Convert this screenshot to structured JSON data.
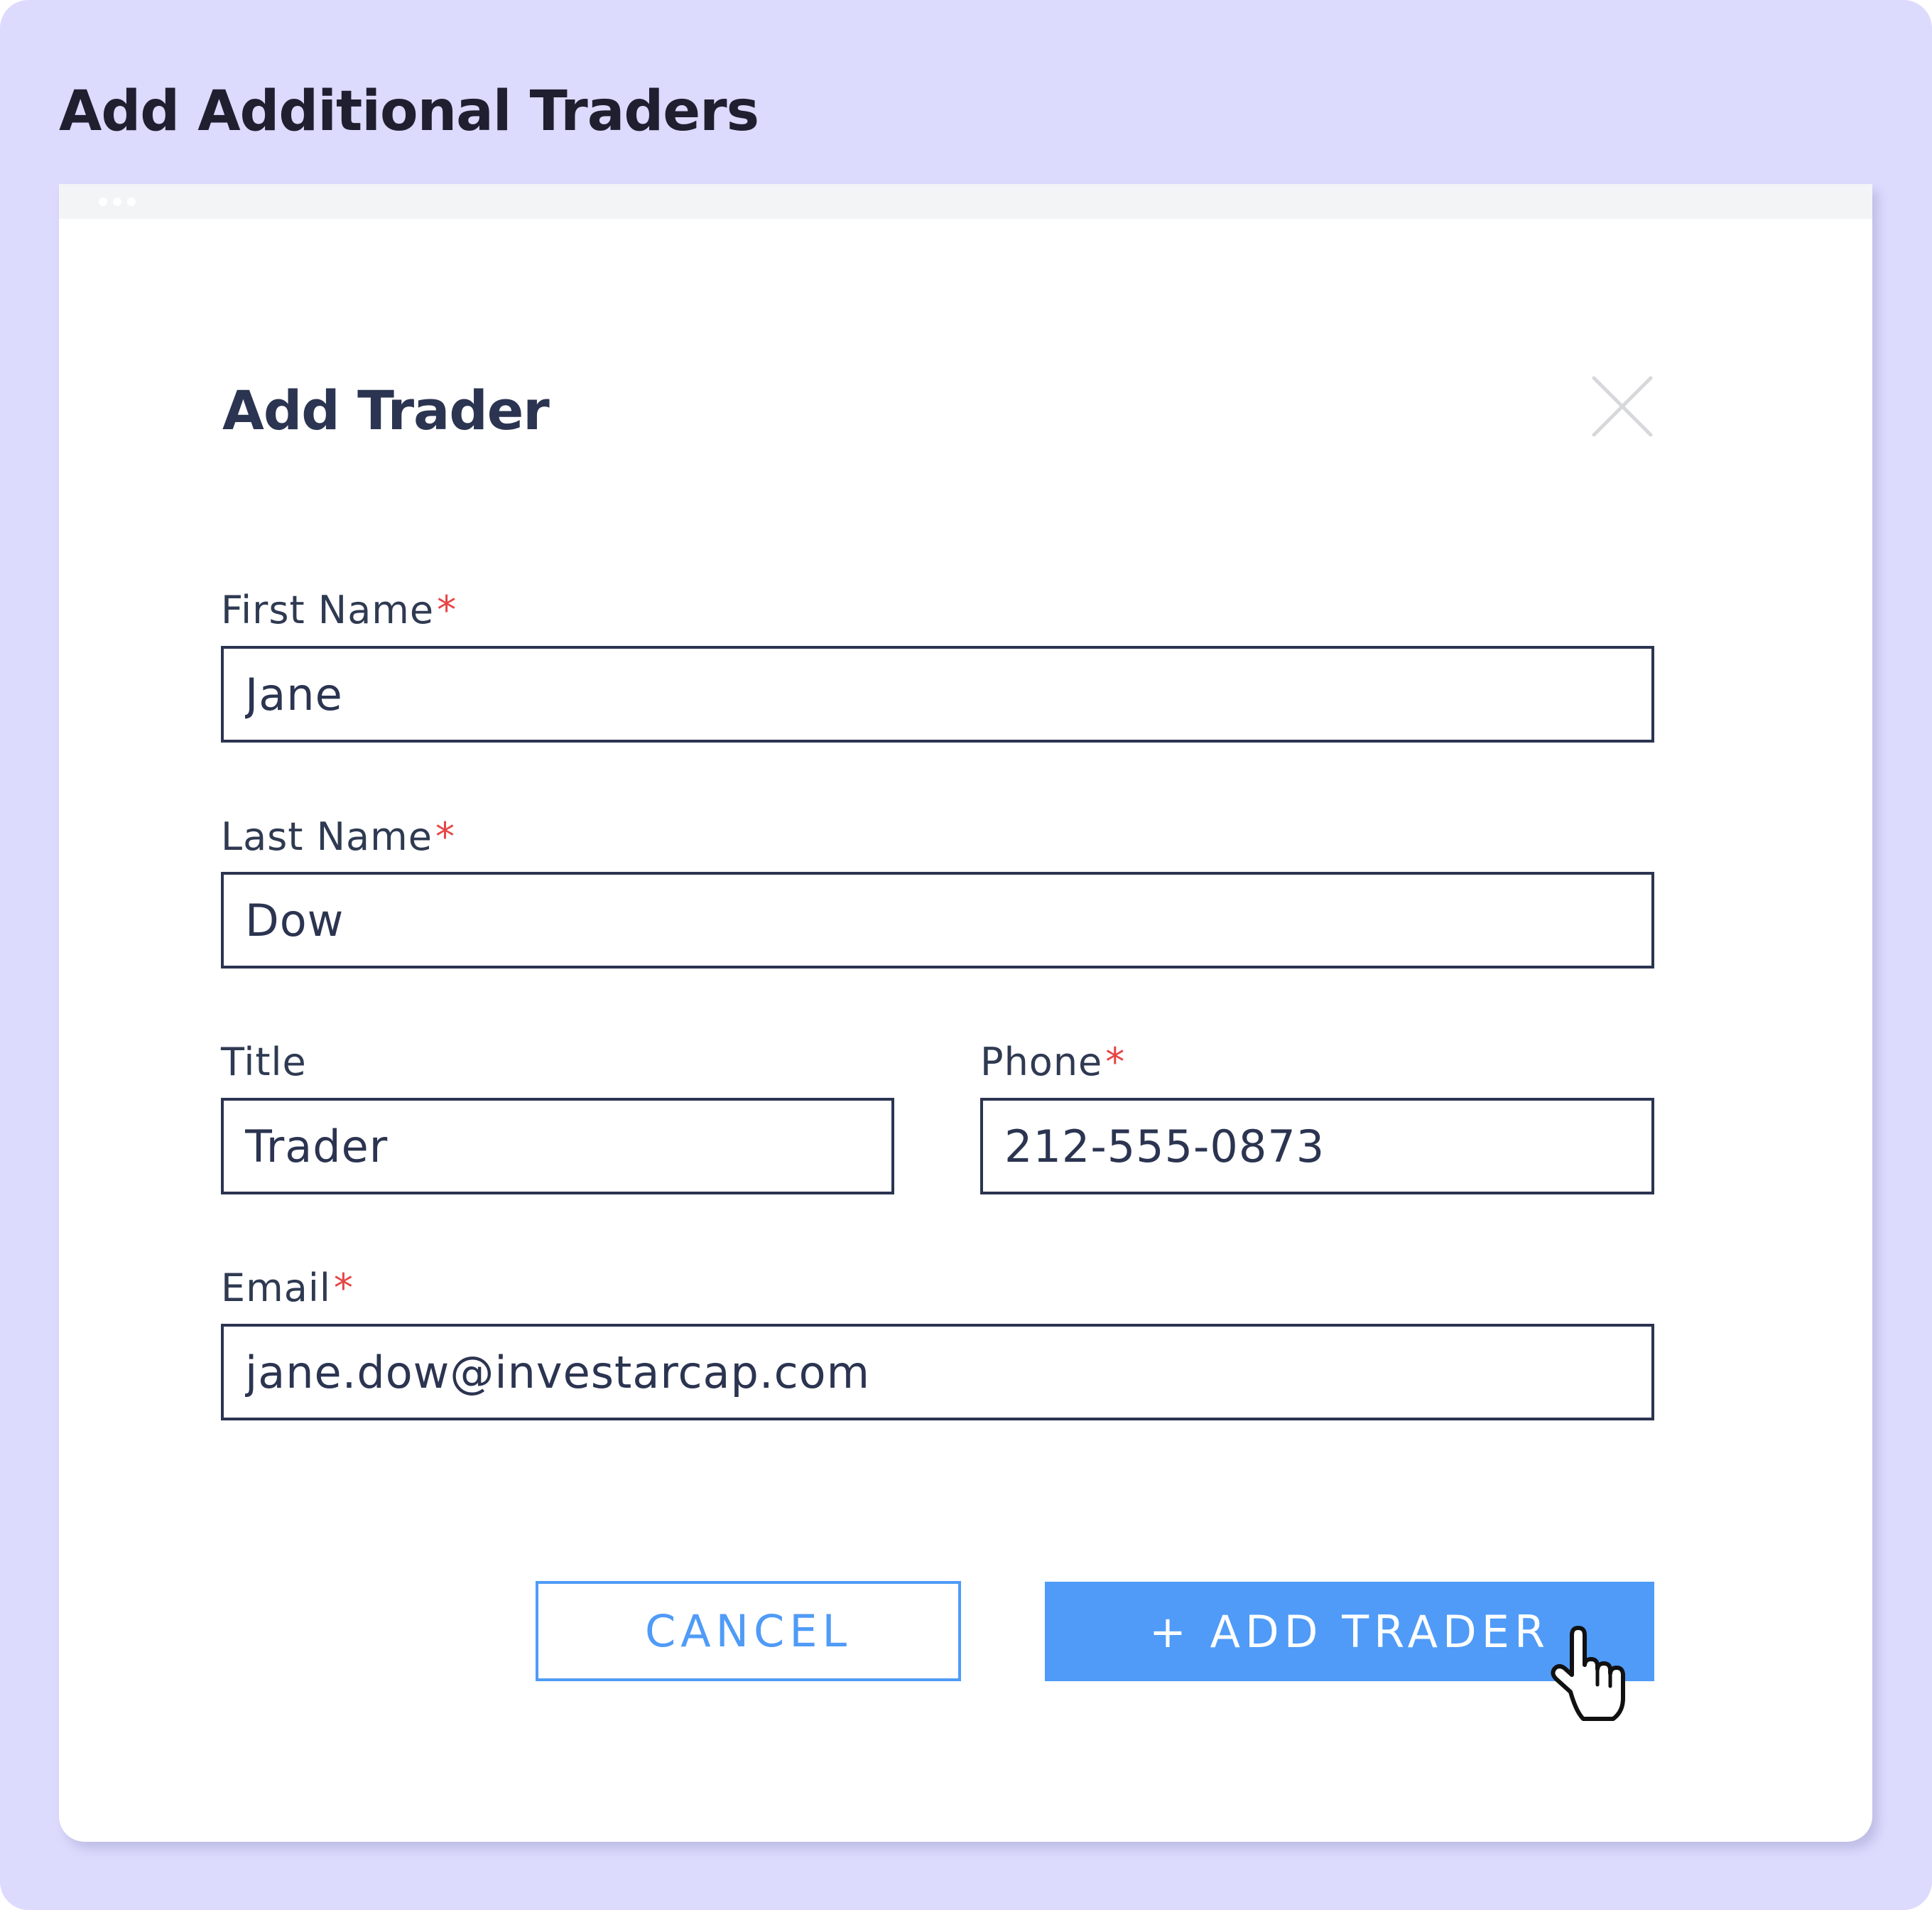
{
  "page": {
    "title": "Add Additional Traders",
    "background_color": "#dcdafd"
  },
  "window": {
    "controls": [
      "dot",
      "dot",
      "dot"
    ]
  },
  "dialog": {
    "title": "Add Trader",
    "close_icon": "close-icon"
  },
  "form": {
    "required_marker": "*",
    "first_name": {
      "label": "First Name",
      "value": "Jane",
      "required": true
    },
    "last_name": {
      "label": "Last Name",
      "value": "Dow",
      "required": true
    },
    "title": {
      "label": "Title",
      "value": "Trader",
      "required": false
    },
    "phone": {
      "label": "Phone",
      "value": "212-555-0873",
      "required": true
    },
    "email": {
      "label": "Email",
      "value": "jane.dow@investarcap.com",
      "required": true
    }
  },
  "actions": {
    "cancel_label": "CANCEL",
    "add_label": "+ ADD TRADER",
    "accent_color": "#4f9bf7"
  },
  "cursor": {
    "icon": "pointer-hand-icon"
  }
}
